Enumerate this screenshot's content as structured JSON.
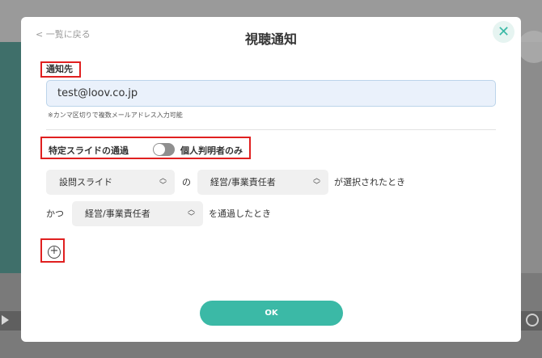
{
  "modal": {
    "back_label": "< 一覧に戻る",
    "title": "視聴通知",
    "close_glyph": "✕"
  },
  "recipient": {
    "label": "通知先",
    "email_value": "test@loov.co.jp",
    "hint": "※カンマ区切りで複数メールアドレス入力可能"
  },
  "filter": {
    "label": "特定スライドの通過",
    "toggle_state": "off",
    "toggle_right_label": "個人判明者のみ"
  },
  "condition_row1": {
    "select1": "設問スライド",
    "connector": "の",
    "select2": "経営/事業責任者",
    "suffix": "が選択されたとき"
  },
  "condition_row2": {
    "prefix": "かつ",
    "select": "経営/事業責任者",
    "suffix": "を通過したとき"
  },
  "add_condition_glyph": "+",
  "ok_label": "OK",
  "colors": {
    "accent": "#3bb9a6",
    "highlight_border": "#e02020",
    "input_bg": "#eaf1fb"
  }
}
